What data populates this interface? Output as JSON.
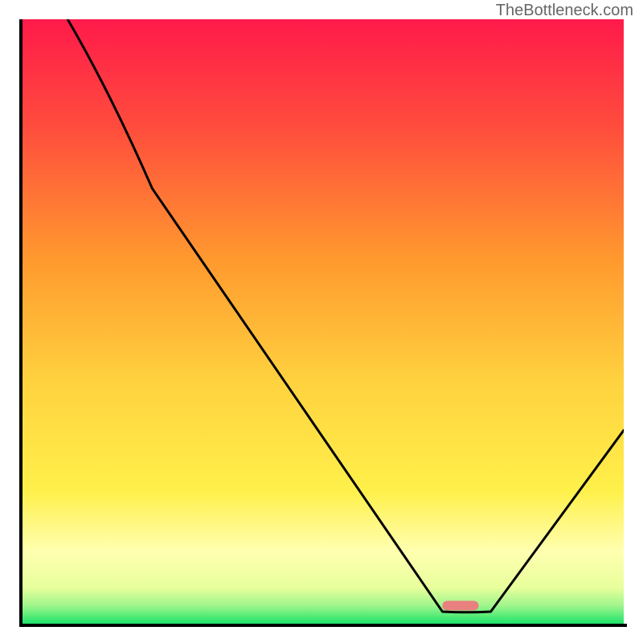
{
  "watermark": "TheBottleneck.com",
  "chart_data": {
    "type": "line",
    "title": "",
    "xlabel": "",
    "ylabel": "",
    "xlim": [
      0,
      100
    ],
    "ylim": [
      0,
      100
    ],
    "gradient_background": {
      "top": "#ff1744",
      "mid_upper": "#ff9800",
      "mid_lower": "#ffeb3b",
      "lower": "#ffffaa",
      "bottom": "#00e676"
    },
    "curve": {
      "description": "Black V-shaped bottleneck curve with minimum around x=73",
      "x": [
        8,
        22,
        70,
        78,
        100
      ],
      "y": [
        100,
        72,
        2,
        2,
        32
      ]
    },
    "marker": {
      "description": "Pink/coral rounded dash at the minimum of the curve",
      "x_center": 73,
      "y": 3,
      "width_pct": 6,
      "color": "#e88080"
    }
  }
}
